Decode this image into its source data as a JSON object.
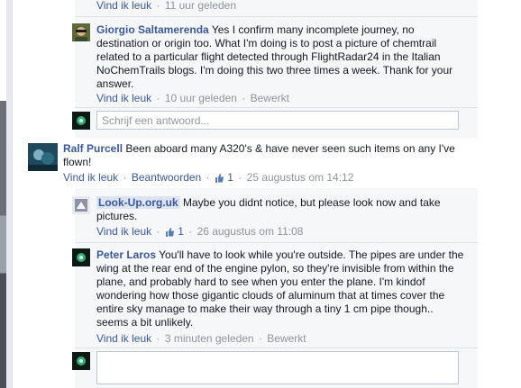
{
  "comments": {
    "c0": {
      "meta": {
        "like": "Vind ik leuk",
        "time": "11 uur geleden"
      }
    },
    "c1": {
      "author": "Giorgio Saltamerenda",
      "text": "Yes I confirm many incomplete journey, no destination or origin too. What I'm doing is to post a picture of chemtrail related to a particular flight detected through FlightRadar24 in the Italian NoChemTrails blogs. I'm doing this two three times a week. Thank for your answer.",
      "meta": {
        "like": "Vind ik leuk",
        "time": "10 uur geleden",
        "edited": "Bewerkt"
      }
    },
    "reply_box_1": {
      "placeholder": "Schrijf een antwoord..."
    },
    "c2": {
      "author": "Ralf Purcell",
      "text": "Been aboard many A320's & have never seen such items on any I've flown!",
      "meta": {
        "like": "Vind ik leuk",
        "reply": "Beantwoorden",
        "likes": "1",
        "time": "25 augustus om 14:12"
      }
    },
    "c3": {
      "author": "Look-Up.org.uk",
      "text": "Maybe you didnt notice, but please look now and take pictures.",
      "meta": {
        "like": "Vind ik leuk",
        "likes": "1",
        "time": "26 augustus om 11:08"
      }
    },
    "c4": {
      "author": "Peter Laros",
      "text": "You'll have to look while you're outside. The pipes are under the wing at the rear end of the engine pylon, so they're invisible from within the plane, and probably hard to see when you enter the plane. I'm kindof wondering how those gigantic clouds of aluminum that at times cover the entire sky manage to make their way through a tiny 1 cm pipe though.. seems a bit unlikely.",
      "meta": {
        "like": "Vind ik leuk",
        "time": "3 minuten geleden",
        "edited": "Bewerkt"
      }
    },
    "reply_box_2": {
      "placeholder": ""
    }
  },
  "sep": "·",
  "icons": {
    "like": "thumbs-up-icon"
  },
  "colors": {
    "link": "#3b5998",
    "meta": "#90949c",
    "panel": "#f6f7f8"
  }
}
